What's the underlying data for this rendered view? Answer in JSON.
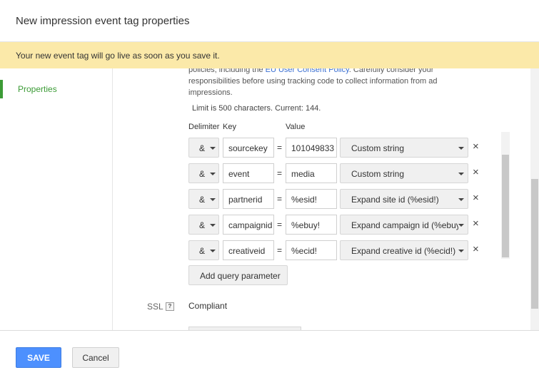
{
  "dialog": {
    "title": "New impression event tag properties",
    "notice": "Your new event tag will go live as soon as you save it."
  },
  "nav": {
    "items": [
      {
        "label": "Properties",
        "active": true
      }
    ],
    "accent_color": "#3c9b36"
  },
  "policy": {
    "line1_prefix": "policies, including the ",
    "link_text": "EU User Consent Policy",
    "line1_suffix": ". Carefully consider your",
    "line2": "responsibilities before using tracking code to collect information from ad",
    "line3": "impressions.",
    "limit_text": "Limit is 500 characters. Current: 144."
  },
  "params": {
    "headers": {
      "delimiter": "Delimiter",
      "key": "Key",
      "value": "Value"
    },
    "rows": [
      {
        "delimiter": "&",
        "key": "sourcekey",
        "value": "101049833",
        "type": "Custom string"
      },
      {
        "delimiter": "&",
        "key": "event",
        "value": "media",
        "type": "Custom string"
      },
      {
        "delimiter": "&",
        "key": "partnerid",
        "value": "%esid!",
        "type": "Expand site id (%esid!)"
      },
      {
        "delimiter": "&",
        "key": "campaignid",
        "value": "%ebuy!",
        "type": "Expand campaign id (%ebuy!)"
      },
      {
        "delimiter": "&",
        "key": "creativeid",
        "value": "%ecid!",
        "type": "Expand creative id (%ecid!)"
      }
    ],
    "remove_glyph": "×",
    "add_label": "Add query parameter"
  },
  "ssl": {
    "label": "SSL",
    "help_glyph": "?",
    "value": "Compliant"
  },
  "footer": {
    "save_label": "SAVE",
    "cancel_label": "Cancel",
    "primary_color": "#4d90fe"
  }
}
